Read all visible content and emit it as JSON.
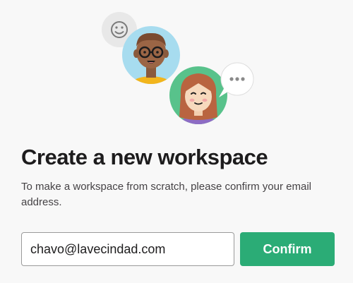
{
  "header": {
    "title": "Create a new workspace",
    "description": "To make a workspace from scratch, please confirm your email address."
  },
  "form": {
    "email_value": "chavo@lavecindad.com",
    "confirm_label": "Confirm"
  },
  "illustration": {
    "icons": [
      "smiley-icon",
      "ellipsis-icon"
    ]
  },
  "colors": {
    "accent": "#2bac76",
    "background": "#f8f8f8",
    "title": "#1d1c1d",
    "avatar_bg_blue": "#a7dcef",
    "avatar_bg_green": "#58c28b"
  }
}
